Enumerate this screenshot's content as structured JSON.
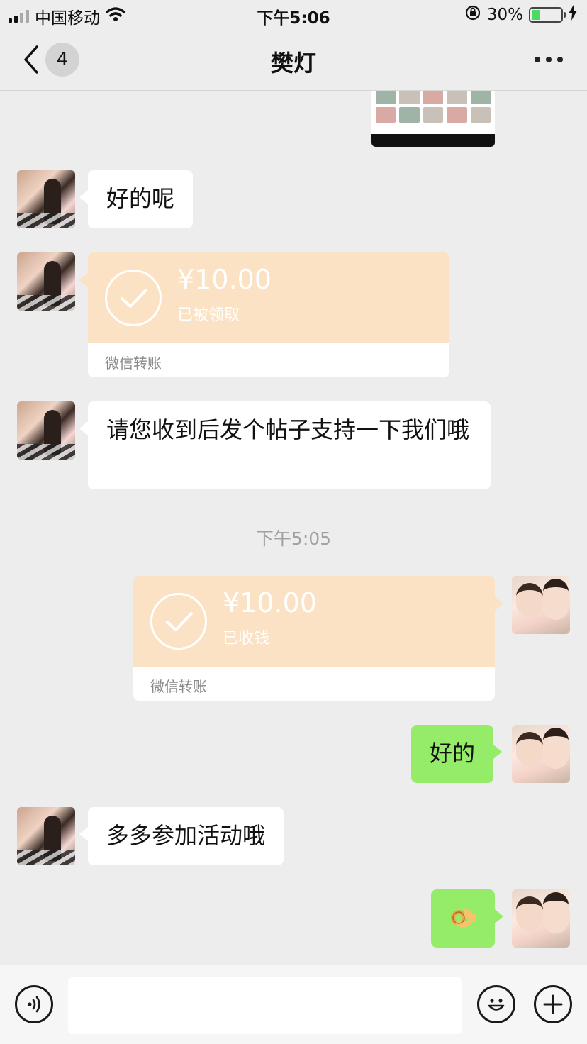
{
  "status_bar": {
    "carrier": "中国移动",
    "time": "下午5:06",
    "battery_percent": "30%",
    "battery_level": 0.3
  },
  "nav": {
    "unread_count": "4",
    "title": "樊灯",
    "back_icon": "chevron-left-icon",
    "more_icon": "more-dots-icon"
  },
  "messages": [
    {
      "side": "left",
      "type": "text",
      "text": "好的呢"
    },
    {
      "side": "left",
      "type": "transfer",
      "amount": "¥10.00",
      "status": "已被领取",
      "footer": "微信转账"
    },
    {
      "side": "left",
      "type": "text",
      "text": "请您收到后发个帖子支持一下我们哦"
    },
    {
      "type": "timestamp",
      "text": "下午5:05"
    },
    {
      "side": "right",
      "type": "transfer",
      "amount": "¥10.00",
      "status": "已收钱",
      "footer": "微信转账"
    },
    {
      "side": "right",
      "type": "text",
      "text": "好的"
    },
    {
      "side": "left",
      "type": "text",
      "text": "多多参加活动哦"
    },
    {
      "side": "right",
      "type": "emoji",
      "emoji": "ok-hand-emoji"
    }
  ],
  "input_bar": {
    "voice_icon": "voice-icon",
    "emoji_icon": "smiley-icon",
    "plus_icon": "plus-icon",
    "text_value": ""
  },
  "colors": {
    "background": "#ededed",
    "bubble_sent": "#95ec69",
    "bubble_received": "#ffffff",
    "transfer_card": "#fce2c4",
    "timestamp": "#a0a0a0"
  }
}
